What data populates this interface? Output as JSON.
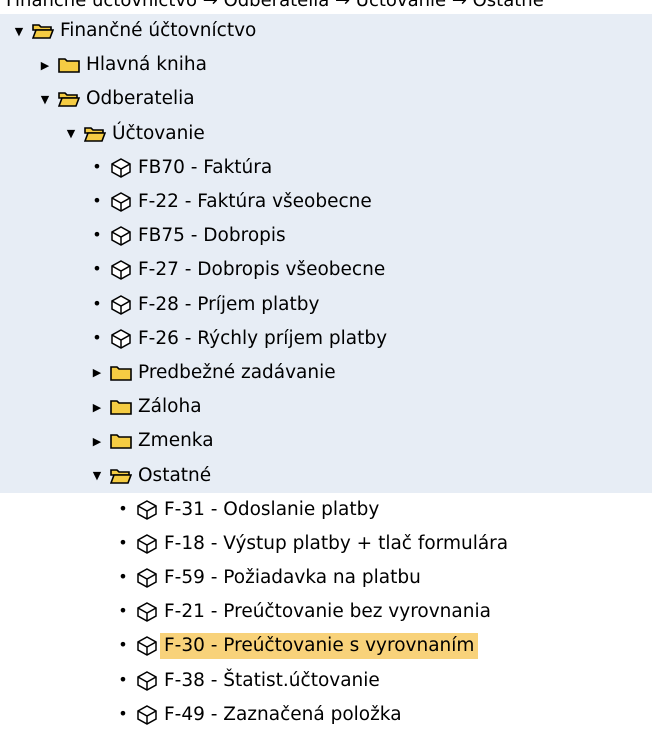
{
  "breadcrumb": "Finančné účtovníctvo → Odberatelia → Účtovanie → Ostatné",
  "tree": [
    {
      "kind": "folder",
      "open": true,
      "level": 0,
      "label": "Finančné účtovníctvo"
    },
    {
      "kind": "folder",
      "open": false,
      "level": 1,
      "label": "Hlavná kniha"
    },
    {
      "kind": "folder",
      "open": true,
      "level": 1,
      "label": "Odberatelia"
    },
    {
      "kind": "folder",
      "open": true,
      "level": 2,
      "label": "Účtovanie"
    },
    {
      "kind": "tx",
      "level": 3,
      "label": "FB70 - Faktúra"
    },
    {
      "kind": "tx",
      "level": 3,
      "label": "F-22 - Faktúra všeobecne"
    },
    {
      "kind": "tx",
      "level": 3,
      "label": "FB75 - Dobropis"
    },
    {
      "kind": "tx",
      "level": 3,
      "label": "F-27 - Dobropis všeobecne"
    },
    {
      "kind": "tx",
      "level": 3,
      "label": "F-28 - Príjem platby"
    },
    {
      "kind": "tx",
      "level": 3,
      "label": "F-26 - Rýchly príjem platby"
    },
    {
      "kind": "folder",
      "open": false,
      "level": 3,
      "label": "Predbežné zadávanie"
    },
    {
      "kind": "folder",
      "open": false,
      "level": 3,
      "label": "Záloha"
    },
    {
      "kind": "folder",
      "open": false,
      "level": 3,
      "label": "Zmenka"
    },
    {
      "kind": "folder",
      "open": true,
      "level": 3,
      "label": "Ostatné"
    },
    {
      "kind": "tx",
      "level": 4,
      "label": "F-31 - Odoslanie platby"
    },
    {
      "kind": "tx",
      "level": 4,
      "label": "F-18 - Výstup platby + tlač formulára"
    },
    {
      "kind": "tx",
      "level": 4,
      "label": "F-59 - Požiadavka na platbu"
    },
    {
      "kind": "tx",
      "level": 4,
      "label": "F-21 - Preúčtovanie bez vyrovnania"
    },
    {
      "kind": "tx",
      "level": 4,
      "label": "F-30 - Preúčtovanie s vyrovnaním",
      "selected": true
    },
    {
      "kind": "tx",
      "level": 4,
      "label": "F-38 - Štatist.účtovanie"
    },
    {
      "kind": "tx",
      "level": 4,
      "label": "F-49 - Zaznačená položka"
    }
  ],
  "colors": {
    "band": "#e7edf5",
    "selection": "#f8d27a",
    "folder": "#f5cc43"
  }
}
